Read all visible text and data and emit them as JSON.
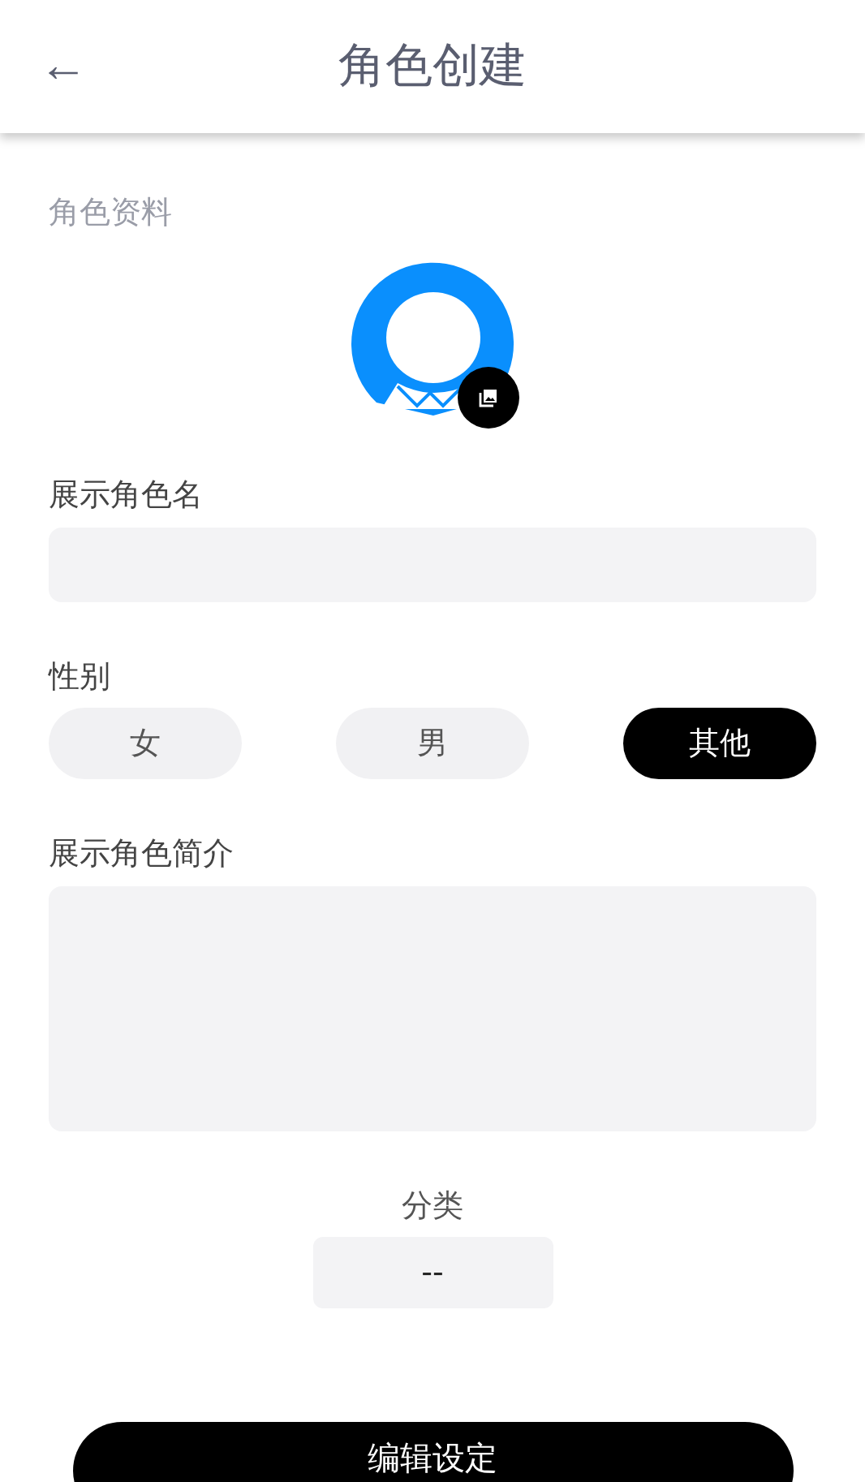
{
  "header": {
    "back_icon": "←",
    "title": "角色创建"
  },
  "section_title": "角色资料",
  "name_field": {
    "label": "展示角色名"
  },
  "gender": {
    "label": "性别",
    "options": [
      {
        "label": "女",
        "selected": false
      },
      {
        "label": "男",
        "selected": false
      },
      {
        "label": "其他",
        "selected": true
      }
    ]
  },
  "intro_field": {
    "label": "展示角色简介"
  },
  "category": {
    "label": "分类",
    "value": "--"
  },
  "submit_button": "编辑设定"
}
